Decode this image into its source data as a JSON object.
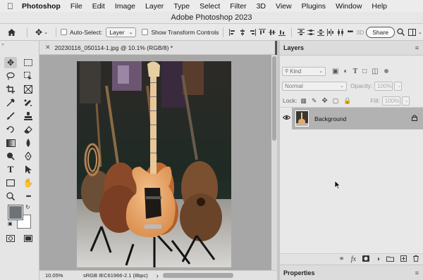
{
  "menubar": {
    "apple": "",
    "items": [
      "Photoshop",
      "File",
      "Edit",
      "Image",
      "Layer",
      "Type",
      "Select",
      "Filter",
      "3D",
      "View",
      "Plugins",
      "Window",
      "Help"
    ]
  },
  "window": {
    "title": "Adobe Photoshop 2023"
  },
  "options": {
    "auto_select_label": "Auto-Select:",
    "auto_select_value": "Layer",
    "show_transform_label": "Show Transform Controls",
    "three_d_label": "3D",
    "share_label": "Share"
  },
  "document": {
    "tab_title": "20230116_050114-1.jpg @ 10.1% (RGB/8) *",
    "zoom": "10.05%",
    "color_profile": "sRGB IEC61966-2.1 (8bpc)"
  },
  "layers_panel": {
    "title": "Layers",
    "kind_label": "Kind",
    "blend_mode": "Normal",
    "opacity_label": "Opacity:",
    "opacity_value": "100%",
    "lock_label": "Lock:",
    "fill_label": "Fill:",
    "fill_value": "100%",
    "layers": [
      {
        "name": "Background",
        "visible": true,
        "locked": true
      }
    ]
  },
  "properties_panel": {
    "title": "Properties"
  },
  "colors": {
    "foreground": "#6e7378",
    "background": "#ffffff"
  }
}
